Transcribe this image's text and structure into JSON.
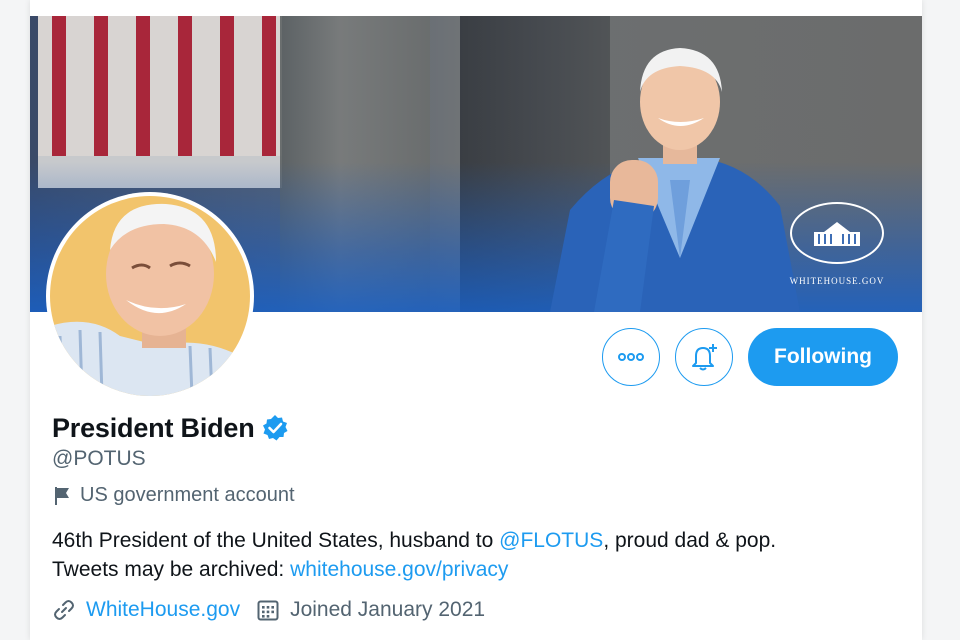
{
  "header": {
    "banner": {
      "logo_caption": "WHITEHOUSE.GOV",
      "accent_color": "#1b5fbe"
    }
  },
  "actions": {
    "more_icon": "ellipsis-icon",
    "notify_icon": "bell-plus-icon",
    "follow_label": "Following",
    "accent_color": "#1d9bf0"
  },
  "profile": {
    "display_name": "President Biden",
    "verified_icon": "verified-badge-icon",
    "handle": "@POTUS",
    "account_label": "US government account",
    "bio": {
      "line1_prefix": "46th President of the United States, husband to ",
      "line1_mention": "@FLOTUS",
      "line1_suffix": ", proud dad & pop.",
      "line2_prefix": "Tweets may be archived: ",
      "line2_link": "whitehouse.gov/privacy"
    },
    "website": "WhiteHouse.gov",
    "joined": "Joined January 2021"
  }
}
